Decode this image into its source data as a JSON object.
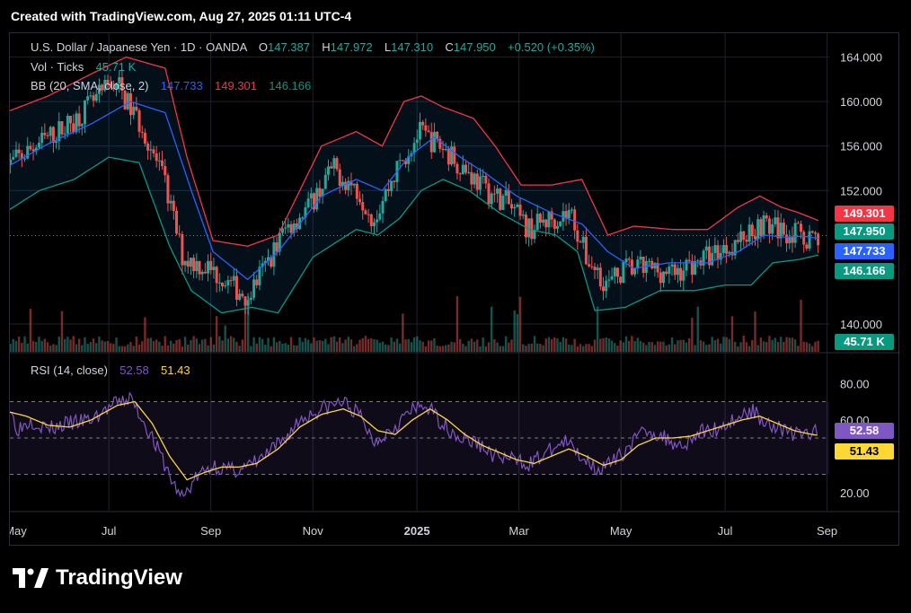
{
  "header": {
    "created_text": "Created with TradingView.com, Aug 27, 2025 01:11 UTC-4"
  },
  "legend": {
    "title": "U.S. Dollar / Japanese Yen · 1D · OANDA",
    "o_label": "O",
    "o_value": "147.387",
    "h_label": "H",
    "h_value": "147.972",
    "l_label": "L",
    "l_value": "147.310",
    "c_label": "C",
    "c_value": "147.950",
    "change": "+0.520 (+0.35%)",
    "vol_label": "Vol · Ticks",
    "vol_value": "45.71 K",
    "bb_label": "BB (20, SMA, close, 2)",
    "bb_basis": "147.733",
    "bb_upper": "149.301",
    "bb_lower": "146.166",
    "rsi_label": "RSI (14, close)",
    "rsi_value": "52.58",
    "rsi_ma": "51.43"
  },
  "badges": {
    "upper": "149.301",
    "close": "147.950",
    "basis": "147.733",
    "lower": "146.166",
    "volume": "45.71 K",
    "rsi": "52.58",
    "rsi_ma": "51.43"
  },
  "colors": {
    "up": "#26a69a",
    "down": "#ef5350",
    "upper_band": "#f23645",
    "basis": "#2962ff",
    "lower_band": "#089981",
    "rsi": "#7e57c2",
    "rsi_ma": "#fdd835",
    "grid": "#1e222d",
    "text": "#d1d4dc"
  },
  "chart_data": {
    "type": "candlestick",
    "symbol": "USDJPY",
    "price_axis": {
      "ticks": [
        "164.000",
        "160.000",
        "156.000",
        "152.000",
        "140.000"
      ],
      "ylim": [
        137.5,
        165.5
      ]
    },
    "rsi_axis": {
      "ticks": [
        "80.00",
        "60.00",
        "20.00"
      ],
      "ylim": [
        10,
        92
      ],
      "bands": [
        70,
        50,
        30
      ]
    },
    "time_labels": [
      "May",
      "Jul",
      "Sep",
      "Nov",
      "2025",
      "Mar",
      "May",
      "Jul",
      "Sep"
    ],
    "time_label_positions": [
      0,
      2.4,
      4.75,
      7.1,
      9.5,
      11.85,
      14.2,
      16.6,
      18.95
    ],
    "path_points": [
      [
        0,
        154
      ],
      [
        0.7,
        156
      ],
      [
        1.5,
        158
      ],
      [
        2.2,
        160.5
      ],
      [
        2.55,
        162
      ],
      [
        2.8,
        160
      ],
      [
        3.2,
        157.5
      ],
      [
        3.7,
        152.5
      ],
      [
        4.1,
        146
      ],
      [
        4.7,
        145
      ],
      [
        5.2,
        143.5
      ],
      [
        5.6,
        142.5
      ],
      [
        6.05,
        145.5
      ],
      [
        6.45,
        148.5
      ],
      [
        7.0,
        150.5
      ],
      [
        7.55,
        154
      ],
      [
        8.15,
        152
      ],
      [
        8.5,
        149.5
      ],
      [
        9.05,
        154
      ],
      [
        9.55,
        157.2
      ],
      [
        10.05,
        156
      ],
      [
        10.6,
        154
      ],
      [
        11.1,
        152
      ],
      [
        11.55,
        151
      ],
      [
        12.05,
        148.5
      ],
      [
        12.6,
        149.5
      ],
      [
        13.05,
        150
      ],
      [
        13.4,
        146
      ],
      [
        13.9,
        143.5
      ],
      [
        14.3,
        145
      ],
      [
        14.9,
        145
      ],
      [
        15.4,
        144.5
      ],
      [
        15.9,
        145.5
      ],
      [
        16.4,
        146.5
      ],
      [
        16.9,
        147.5
      ],
      [
        17.4,
        149
      ],
      [
        17.9,
        148.5
      ],
      [
        18.4,
        147.8
      ],
      [
        18.8,
        147.95
      ]
    ],
    "bollinger": {
      "upper_points": [
        [
          0,
          159
        ],
        [
          1,
          160.5
        ],
        [
          2,
          162.5
        ],
        [
          2.8,
          164
        ],
        [
          3.7,
          163
        ],
        [
          4.2,
          155
        ],
        [
          4.8,
          147.5
        ],
        [
          5.6,
          147
        ],
        [
          6.3,
          148
        ],
        [
          7.3,
          156
        ],
        [
          8.1,
          157.3
        ],
        [
          8.7,
          156
        ],
        [
          9.2,
          160
        ],
        [
          9.6,
          160.5
        ],
        [
          10.1,
          159.5
        ],
        [
          10.8,
          158.5
        ],
        [
          11.3,
          156
        ],
        [
          11.9,
          152.5
        ],
        [
          12.6,
          152.5
        ],
        [
          13.3,
          153
        ],
        [
          13.9,
          148
        ],
        [
          14.5,
          148.8
        ],
        [
          15.4,
          148.5
        ],
        [
          16.2,
          148.5
        ],
        [
          16.9,
          150.5
        ],
        [
          17.4,
          151.5
        ],
        [
          17.9,
          150.5
        ],
        [
          18.3,
          150
        ],
        [
          18.75,
          149.3
        ]
      ],
      "basis_points": [
        [
          0,
          154
        ],
        [
          1,
          156.2
        ],
        [
          2,
          158
        ],
        [
          2.9,
          160
        ],
        [
          3.7,
          159
        ],
        [
          4.3,
          152
        ],
        [
          4.8,
          146.5
        ],
        [
          5.6,
          144
        ],
        [
          6.3,
          146.5
        ],
        [
          7.3,
          151.5
        ],
        [
          8.1,
          153
        ],
        [
          8.7,
          152
        ],
        [
          9.3,
          155
        ],
        [
          9.9,
          156.8
        ],
        [
          10.5,
          155
        ],
        [
          11.1,
          153.5
        ],
        [
          11.8,
          151.5
        ],
        [
          12.6,
          150
        ],
        [
          13.3,
          149
        ],
        [
          13.9,
          146.5
        ],
        [
          14.5,
          145
        ],
        [
          15.3,
          145.5
        ],
        [
          16.2,
          145.5
        ],
        [
          16.9,
          146.5
        ],
        [
          17.5,
          148
        ],
        [
          18.0,
          147.8
        ],
        [
          18.4,
          147.9
        ],
        [
          18.75,
          147.7
        ]
      ],
      "lower_points": [
        [
          0,
          150
        ],
        [
          0.8,
          152
        ],
        [
          1.6,
          153
        ],
        [
          2.4,
          155
        ],
        [
          3.1,
          154.5
        ],
        [
          3.8,
          147
        ],
        [
          4.3,
          143
        ],
        [
          5.0,
          141
        ],
        [
          5.7,
          141.5
        ],
        [
          6.3,
          141
        ],
        [
          7.1,
          146
        ],
        [
          8.1,
          148.5
        ],
        [
          8.6,
          148
        ],
        [
          9.1,
          149.5
        ],
        [
          9.6,
          152
        ],
        [
          10.1,
          153
        ],
        [
          10.7,
          152
        ],
        [
          11.4,
          150
        ],
        [
          12.1,
          148.5
        ],
        [
          12.7,
          148
        ],
        [
          13.2,
          146.5
        ],
        [
          13.6,
          141.2
        ],
        [
          14.3,
          141.5
        ],
        [
          15.1,
          143
        ],
        [
          15.9,
          143
        ],
        [
          16.6,
          143.5
        ],
        [
          17.2,
          143.5
        ],
        [
          17.7,
          145.5
        ],
        [
          18.3,
          145.8
        ],
        [
          18.75,
          146.2
        ]
      ]
    },
    "close": 147.95,
    "volume_last": "45.71 K",
    "rsi_points": [
      [
        0,
        72
      ],
      [
        0.3,
        55
      ],
      [
        0.6,
        60
      ],
      [
        1.0,
        55
      ],
      [
        1.5,
        58
      ],
      [
        2.0,
        60
      ],
      [
        2.5,
        68
      ],
      [
        2.9,
        72
      ],
      [
        3.3,
        55
      ],
      [
        3.6,
        40
      ],
      [
        3.9,
        24
      ],
      [
        4.1,
        17
      ],
      [
        4.4,
        28
      ],
      [
        4.8,
        35
      ],
      [
        5.2,
        32
      ],
      [
        5.6,
        34
      ],
      [
        6.0,
        40
      ],
      [
        6.4,
        48
      ],
      [
        6.8,
        60
      ],
      [
        7.3,
        66
      ],
      [
        7.8,
        70
      ],
      [
        8.2,
        62
      ],
      [
        8.5,
        48
      ],
      [
        8.9,
        55
      ],
      [
        9.3,
        64
      ],
      [
        9.7,
        68
      ],
      [
        10.1,
        58
      ],
      [
        10.5,
        50
      ],
      [
        10.9,
        47
      ],
      [
        11.3,
        40
      ],
      [
        11.7,
        38
      ],
      [
        12.1,
        36
      ],
      [
        12.5,
        42
      ],
      [
        12.9,
        48
      ],
      [
        13.3,
        40
      ],
      [
        13.7,
        33
      ],
      [
        14.0,
        36
      ],
      [
        14.4,
        46
      ],
      [
        14.8,
        55
      ],
      [
        15.2,
        50
      ],
      [
        15.6,
        46
      ],
      [
        16.0,
        53
      ],
      [
        16.4,
        55
      ],
      [
        16.8,
        60
      ],
      [
        17.2,
        65
      ],
      [
        17.5,
        60
      ],
      [
        17.8,
        56
      ],
      [
        18.2,
        52
      ],
      [
        18.6,
        53
      ],
      [
        18.75,
        52.6
      ]
    ],
    "rsi_ma_points": [
      [
        0,
        65
      ],
      [
        0.5,
        62
      ],
      [
        1.0,
        57
      ],
      [
        1.5,
        56
      ],
      [
        2.0,
        60
      ],
      [
        2.6,
        68
      ],
      [
        3.0,
        70
      ],
      [
        3.4,
        58
      ],
      [
        3.8,
        40
      ],
      [
        4.2,
        27
      ],
      [
        4.6,
        31
      ],
      [
        5.0,
        34
      ],
      [
        5.4,
        34
      ],
      [
        5.8,
        36
      ],
      [
        6.3,
        44
      ],
      [
        6.8,
        56
      ],
      [
        7.3,
        63
      ],
      [
        7.8,
        66
      ],
      [
        8.2,
        62
      ],
      [
        8.6,
        54
      ],
      [
        9.0,
        52
      ],
      [
        9.4,
        60
      ],
      [
        9.8,
        66
      ],
      [
        10.2,
        60
      ],
      [
        10.6,
        52
      ],
      [
        11.0,
        46
      ],
      [
        11.4,
        42
      ],
      [
        11.8,
        38
      ],
      [
        12.2,
        36
      ],
      [
        12.6,
        40
      ],
      [
        13.0,
        44
      ],
      [
        13.4,
        40
      ],
      [
        13.8,
        35
      ],
      [
        14.2,
        38
      ],
      [
        14.6,
        46
      ],
      [
        15.0,
        50
      ],
      [
        15.4,
        50
      ],
      [
        15.8,
        51
      ],
      [
        16.2,
        54
      ],
      [
        16.6,
        57
      ],
      [
        17.0,
        60
      ],
      [
        17.4,
        62
      ],
      [
        17.8,
        58
      ],
      [
        18.2,
        54
      ],
      [
        18.6,
        52
      ],
      [
        18.75,
        51.4
      ]
    ]
  }
}
